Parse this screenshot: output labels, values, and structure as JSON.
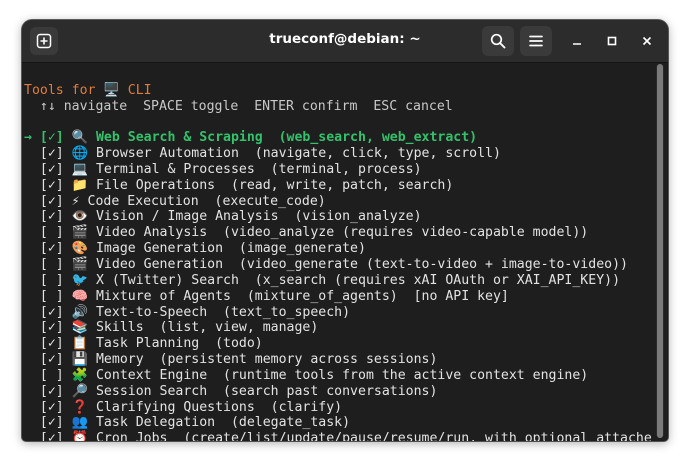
{
  "window": {
    "title": "trueconf@debian: ~"
  },
  "terminal": {
    "header": "Tools for 🖥️ CLI",
    "hint": "  ↑↓ navigate  SPACE toggle  ENTER confirm  ESC cancel",
    "selected_line": "→ [✓] 🔍 Web Search & Scraping  (web_search, web_extract)",
    "lines": [
      "  [✓] 🌐 Browser Automation  (navigate, click, type, scroll)",
      "  [✓] 💻 Terminal & Processes  (terminal, process)",
      "  [✓] 📁 File Operations  (read, write, patch, search)",
      "  [✓] ⚡ Code Execution  (execute_code)",
      "  [✓] 👁️ Vision / Image Analysis  (vision_analyze)",
      "  [ ] 🎬 Video Analysis  (video_analyze (requires video-capable model))",
      "  [✓] 🎨 Image Generation  (image_generate)",
      "  [ ] 🎬 Video Generation  (video_generate (text-to-video + image-to-video))",
      "  [ ] 🐦 X (Twitter) Search  (x_search (requires xAI OAuth or XAI_API_KEY))",
      "  [ ] 🧠 Mixture of Agents  (mixture_of_agents)  [no API key]",
      "  [✓] 🔊 Text-to-Speech  (text_to_speech)",
      "  [✓] 📚 Skills  (list, view, manage)",
      "  [✓] 📋 Task Planning  (todo)",
      "  [✓] 💾 Memory  (persistent memory across sessions)",
      "  [ ] 🧩 Context Engine  (runtime tools from the active context engine)",
      "  [✓] 🔎 Session Search  (search past conversations)",
      "  [✓] ❓ Clarifying Questions  (clarify)",
      "  [✓] 👥 Task Delegation  (delegate_task)",
      "  [✓] ⏰ Cron Jobs  (create/list/update/pause/resume/run, with optional attache"
    ]
  },
  "icons": {
    "new_tab": "new-tab-icon",
    "search": "search-icon",
    "menu": "hamburger-menu-icon",
    "minimize": "minimize-icon",
    "maximize": "maximize-icon",
    "close": "close-icon"
  },
  "colors": {
    "background": "#1e1e1e",
    "header": "#e07c3a",
    "selected": "#33c26b",
    "text": "#e3e3e3"
  }
}
